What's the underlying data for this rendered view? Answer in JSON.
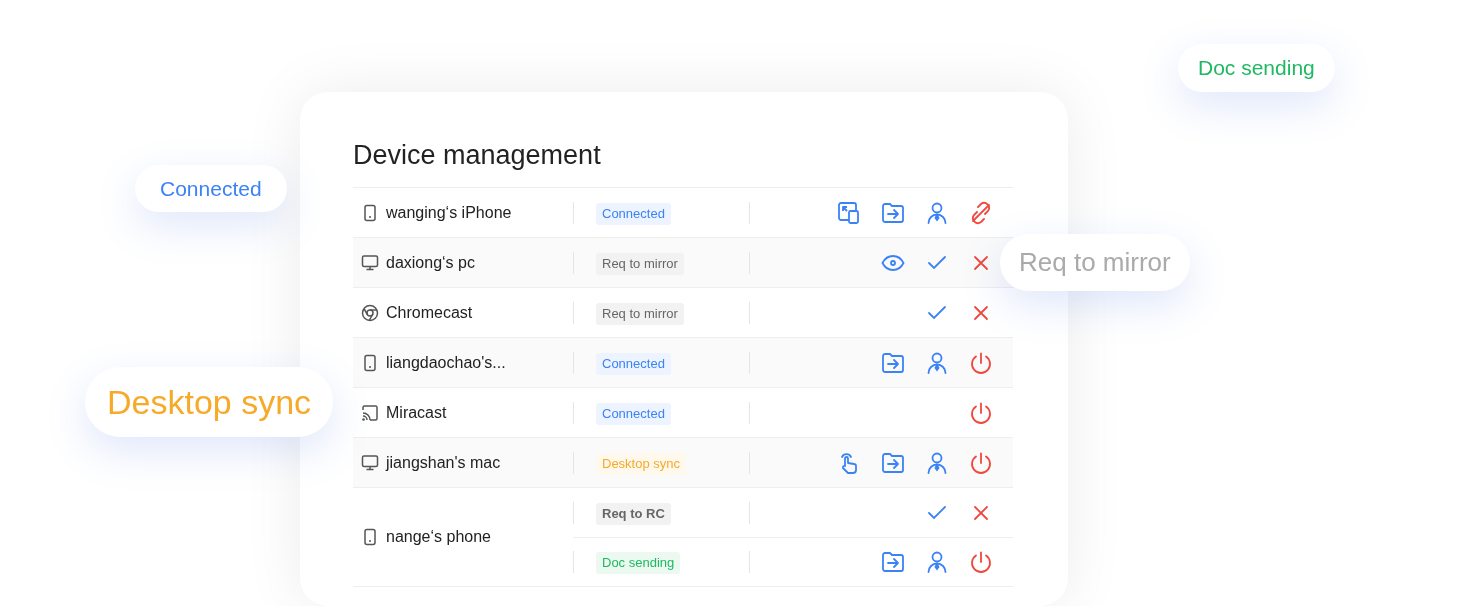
{
  "panel": {
    "title": "Device management"
  },
  "devices": [
    {
      "kind": "phone",
      "name": "wanging‘s iPhone",
      "statuses": [
        {
          "label": "Connected",
          "kind": "connected",
          "bold": false,
          "actions": [
            {
              "kind": "mirror"
            },
            {
              "kind": "send-file"
            },
            {
              "kind": "remote"
            },
            {
              "kind": "unlink"
            }
          ]
        }
      ]
    },
    {
      "kind": "monitor",
      "name": "daxiong‘s pc",
      "statuses": [
        {
          "label": "Req to mirror",
          "kind": "request",
          "bold": false,
          "actions": [
            {
              "kind": "view"
            },
            {
              "kind": "accept"
            },
            {
              "kind": "reject"
            }
          ]
        }
      ]
    },
    {
      "kind": "chrome",
      "name": "Chromecast",
      "statuses": [
        {
          "label": "Req to mirror",
          "kind": "request",
          "bold": false,
          "actions": [
            {
              "kind": "accept"
            },
            {
              "kind": "reject"
            }
          ]
        }
      ]
    },
    {
      "kind": "phone",
      "name": "liangdaochao's...",
      "statuses": [
        {
          "label": "Connected",
          "kind": "connected",
          "bold": false,
          "actions": [
            {
              "kind": "send-file"
            },
            {
              "kind": "remote"
            },
            {
              "kind": "power"
            }
          ]
        }
      ]
    },
    {
      "kind": "cast",
      "name": "Miracast",
      "statuses": [
        {
          "label": "Connected",
          "kind": "connected",
          "bold": false,
          "actions": [
            {
              "kind": "power"
            }
          ]
        }
      ]
    },
    {
      "kind": "monitor",
      "name": "jiangshan's mac",
      "statuses": [
        {
          "label": "Desktop sync",
          "kind": "sync",
          "bold": false,
          "actions": [
            {
              "kind": "touch"
            },
            {
              "kind": "send-file"
            },
            {
              "kind": "remote"
            },
            {
              "kind": "power"
            }
          ]
        }
      ]
    },
    {
      "kind": "phone",
      "name": "nange‘s phone",
      "statuses": [
        {
          "label": "Req to RC",
          "kind": "request",
          "bold": true,
          "actions": [
            {
              "kind": "accept"
            },
            {
              "kind": "reject"
            }
          ]
        },
        {
          "label": "Doc sending",
          "kind": "sending",
          "bold": false,
          "actions": [
            {
              "kind": "send-file"
            },
            {
              "kind": "remote"
            },
            {
              "kind": "power"
            }
          ]
        }
      ]
    }
  ],
  "floating_labels": [
    {
      "text": "Doc sending",
      "kind": "sending"
    },
    {
      "text": "Connected",
      "kind": "connected"
    },
    {
      "text": "Req to mirror",
      "kind": "request"
    },
    {
      "text": "Desktop sync",
      "kind": "sync"
    }
  ]
}
